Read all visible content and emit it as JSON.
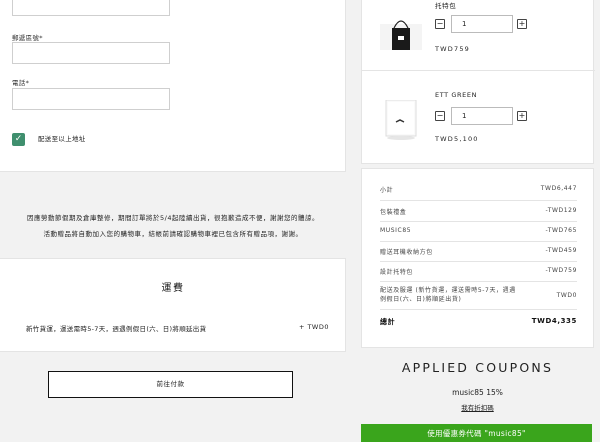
{
  "form": {
    "postal_label": "郵遞區號*",
    "phone_label": "電話*",
    "same_address_label": "配送至以上地址"
  },
  "notice": {
    "line1": "因應勞動節假期及倉庫整修，期間訂單將於5/4起陸續出貨，很抱歉造成不便，謝謝您的體諒。",
    "line2": "活動贈品將自動加入您的購物車，結帳前請確認購物車裡已包含所有贈品項，謝謝。"
  },
  "shipping": {
    "title": "運費",
    "option": "新竹貨運，運送需時5-7天，週遇例假日(六、日)將順延出貨",
    "price": "+ TWD0"
  },
  "checkout": {
    "pay_label": "前往付款"
  },
  "cart": {
    "items": [
      {
        "name": "托特包",
        "qty": "1",
        "price": "TWD759"
      },
      {
        "name": "ETT GREEN",
        "qty": "1",
        "price": "TWD5,100"
      }
    ],
    "minus": "−",
    "plus": "+"
  },
  "summary": {
    "rows": [
      {
        "label": "小計",
        "value": "TWD6,447"
      },
      {
        "label": "包裝禮盒",
        "value": "-TWD129"
      },
      {
        "label": "MUSIC85",
        "value": "-TWD765"
      },
      {
        "label": "贈送耳機收納方包",
        "value": "-TWD459"
      },
      {
        "label": "設計托特包",
        "value": "-TWD759"
      },
      {
        "label": "配送及服運 (新竹貨運，運送需時5-7天，週遇例假日(六、日)將順延出貨)",
        "value": "TWD0"
      }
    ],
    "total_label": "總計",
    "total_value": "TWD4,335"
  },
  "coupons": {
    "title": "APPLIED COUPONS",
    "code": "music85 15%",
    "link": "我有折扣碼",
    "button": "使用優惠券代碼 \"music85\""
  },
  "colors": {
    "accent_green": "#3aa51c",
    "checkbox_green": "#3f8f6e"
  }
}
